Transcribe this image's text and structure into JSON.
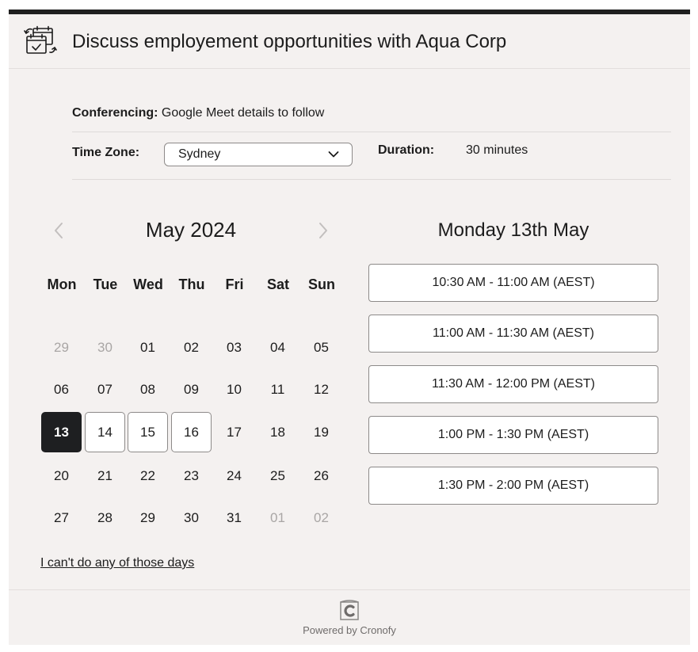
{
  "header": {
    "title": "Discuss employement opportunities with Aqua Corp",
    "icon": "calendar-reschedule-icon"
  },
  "details": {
    "conferencing_label": "Conferencing:",
    "conferencing_value": "Google Meet details to follow",
    "timezone_label": "Time Zone:",
    "timezone_value": "Sydney",
    "duration_label": "Duration:",
    "duration_value": "30 minutes"
  },
  "calendar": {
    "month_label": "May 2024",
    "weekdays": [
      "Mon",
      "Tue",
      "Wed",
      "Thu",
      "Fri",
      "Sat",
      "Sun"
    ],
    "weeks": [
      [
        {
          "d": "29",
          "state": "muted"
        },
        {
          "d": "30",
          "state": "muted"
        },
        {
          "d": "01",
          "state": "normal"
        },
        {
          "d": "02",
          "state": "normal"
        },
        {
          "d": "03",
          "state": "normal"
        },
        {
          "d": "04",
          "state": "normal"
        },
        {
          "d": "05",
          "state": "normal"
        }
      ],
      [
        {
          "d": "06",
          "state": "normal"
        },
        {
          "d": "07",
          "state": "normal"
        },
        {
          "d": "08",
          "state": "normal"
        },
        {
          "d": "09",
          "state": "normal"
        },
        {
          "d": "10",
          "state": "normal"
        },
        {
          "d": "11",
          "state": "normal"
        },
        {
          "d": "12",
          "state": "normal"
        }
      ],
      [
        {
          "d": "13",
          "state": "selected"
        },
        {
          "d": "14",
          "state": "available"
        },
        {
          "d": "15",
          "state": "available"
        },
        {
          "d": "16",
          "state": "available"
        },
        {
          "d": "17",
          "state": "normal"
        },
        {
          "d": "18",
          "state": "normal"
        },
        {
          "d": "19",
          "state": "normal"
        }
      ],
      [
        {
          "d": "20",
          "state": "normal"
        },
        {
          "d": "21",
          "state": "normal"
        },
        {
          "d": "22",
          "state": "normal"
        },
        {
          "d": "23",
          "state": "normal"
        },
        {
          "d": "24",
          "state": "normal"
        },
        {
          "d": "25",
          "state": "normal"
        },
        {
          "d": "26",
          "state": "normal"
        }
      ],
      [
        {
          "d": "27",
          "state": "normal"
        },
        {
          "d": "28",
          "state": "normal"
        },
        {
          "d": "29",
          "state": "normal"
        },
        {
          "d": "30",
          "state": "normal"
        },
        {
          "d": "31",
          "state": "normal"
        },
        {
          "d": "01",
          "state": "muted"
        },
        {
          "d": "02",
          "state": "muted"
        }
      ]
    ],
    "cant_do_link": "I can't do any of those days"
  },
  "slots": {
    "day_title": "Monday 13th May",
    "items": [
      "10:30 AM - 11:00 AM (AEST)",
      "11:00 AM - 11:30 AM (AEST)",
      "11:30 AM - 12:00 PM (AEST)",
      "1:00 PM - 1:30 PM (AEST)",
      "1:30 PM - 2:00 PM (AEST)"
    ]
  },
  "footer": {
    "powered_by": "Powered by Cronofy",
    "logo_letter": "C"
  },
  "colors": {
    "background": "#f4f1f0",
    "selected_day": "#1e1f21",
    "top_border": "#1f1f1f"
  }
}
